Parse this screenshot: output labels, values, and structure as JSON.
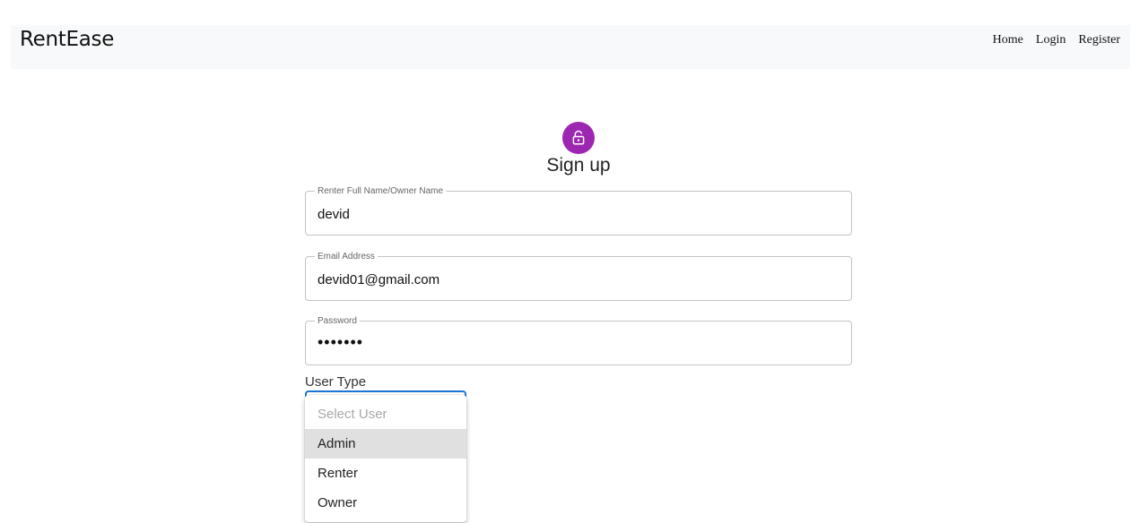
{
  "navbar": {
    "brand": "RentEase",
    "links": [
      "Home",
      "Login",
      "Register"
    ]
  },
  "form": {
    "icon": "lock-icon",
    "title": "Sign up",
    "fields": [
      {
        "label": "Renter Full Name/Owner Name",
        "value": "devid"
      },
      {
        "label": "Email Address",
        "value": "devid01@gmail.com"
      },
      {
        "label": "Password",
        "value": "•••••••"
      }
    ],
    "user_type": {
      "label": "User Type",
      "options": [
        "Select User",
        "Admin",
        "Renter",
        "Owner"
      ],
      "highlighted": "Admin"
    }
  },
  "colors": {
    "accent": "#9c27b0",
    "focus": "#1976d2",
    "navbar_bg": "#f8f9fa"
  }
}
